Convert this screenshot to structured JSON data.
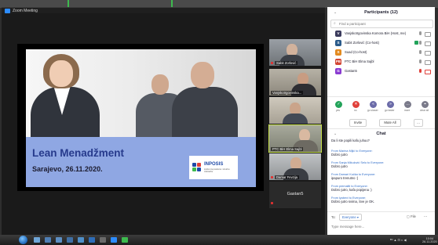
{
  "window": {
    "title": "Zoom Meeting"
  },
  "slide": {
    "title": "Lean Menadžment",
    "date": "Sarajevo, 26.11.2020.",
    "logo_text": "INPOSIS",
    "logo_sub": "institut za poslovnu i stručnu izobrazbu"
  },
  "video_thumbnails": [
    {
      "name": "Sabit Zorlović",
      "muted": true
    },
    {
      "name": "Vanjskotrgovinska...",
      "muted": false
    },
    {
      "name": "",
      "muted": false
    },
    {
      "name": "PTC BiH Elma Sajbl",
      "muted": false,
      "active": true
    },
    {
      "name": "Damar Fevzija",
      "muted": true
    }
  ],
  "video_placeholder": {
    "name": "Gastan5"
  },
  "participants_panel": {
    "title": "Participants (12)",
    "search_placeholder": "Find a participant",
    "participants": [
      {
        "initial": "V",
        "name": "Vanjskotrgovinska Komora BiH (Host, me)",
        "color": "#3a3a5c"
      },
      {
        "initial": "S",
        "name": "Sabit Zorlović (Co-host)",
        "color": "#2a5a8a"
      },
      {
        "initial": "S",
        "name": "Suad (Co-host)",
        "color": "#e38a1e"
      },
      {
        "initial": "PB",
        "name": "PTC BiH Elma Sajbl",
        "color": "#d34735"
      },
      {
        "initial": "G",
        "name": "Gastan5",
        "color": "#8a3bd1"
      }
    ],
    "reactions": [
      {
        "symbol": "✓",
        "label": "yes",
        "color": "#23a35a"
      },
      {
        "symbol": "✕",
        "label": "no",
        "color": "#e0403a"
      },
      {
        "symbol": "«",
        "label": "go slower",
        "color": "#6b6ba8"
      },
      {
        "symbol": "»",
        "label": "go faster",
        "color": "#6b6ba8"
      },
      {
        "symbol": "…",
        "label": "more",
        "color": "#7a7a8a"
      },
      {
        "symbol": "⌖",
        "label": "clear all",
        "color": "#7a7a8a"
      }
    ],
    "invite_label": "Invite",
    "mute_all_label": "Mute All",
    "more_label": "..."
  },
  "chat": {
    "title": "Chat",
    "messages": [
      {
        "from": "",
        "text": "Da li ste popili kafu juhuu?"
      },
      {
        "from": "From Marina Mijić to Everyone:",
        "text": "Dobro jutro"
      },
      {
        "from": "From Sanja Mikulović Selo to Everyone:",
        "text": "Dobro jutro"
      },
      {
        "from": "From Damari Kučka to Everyone:",
        "text": "ipapuro trenutno :)"
      },
      {
        "from": "From premaliti to Everyone:",
        "text": "Dobro jutro, kafa popijena :)"
      },
      {
        "from": "From lyabevi to Everyone:",
        "text": "Dobro jutro svima, Sve je OK."
      }
    ],
    "to_label": "To:",
    "recipient": "Everyone ▾",
    "file_label": "File",
    "more_label": "...",
    "input_placeholder": "Type message here..."
  },
  "taskbar": {
    "tray_text": "ᴱᴺ ▲ ⊡ ◐ ◀",
    "time": "10:04",
    "date": "26.11.2020"
  }
}
